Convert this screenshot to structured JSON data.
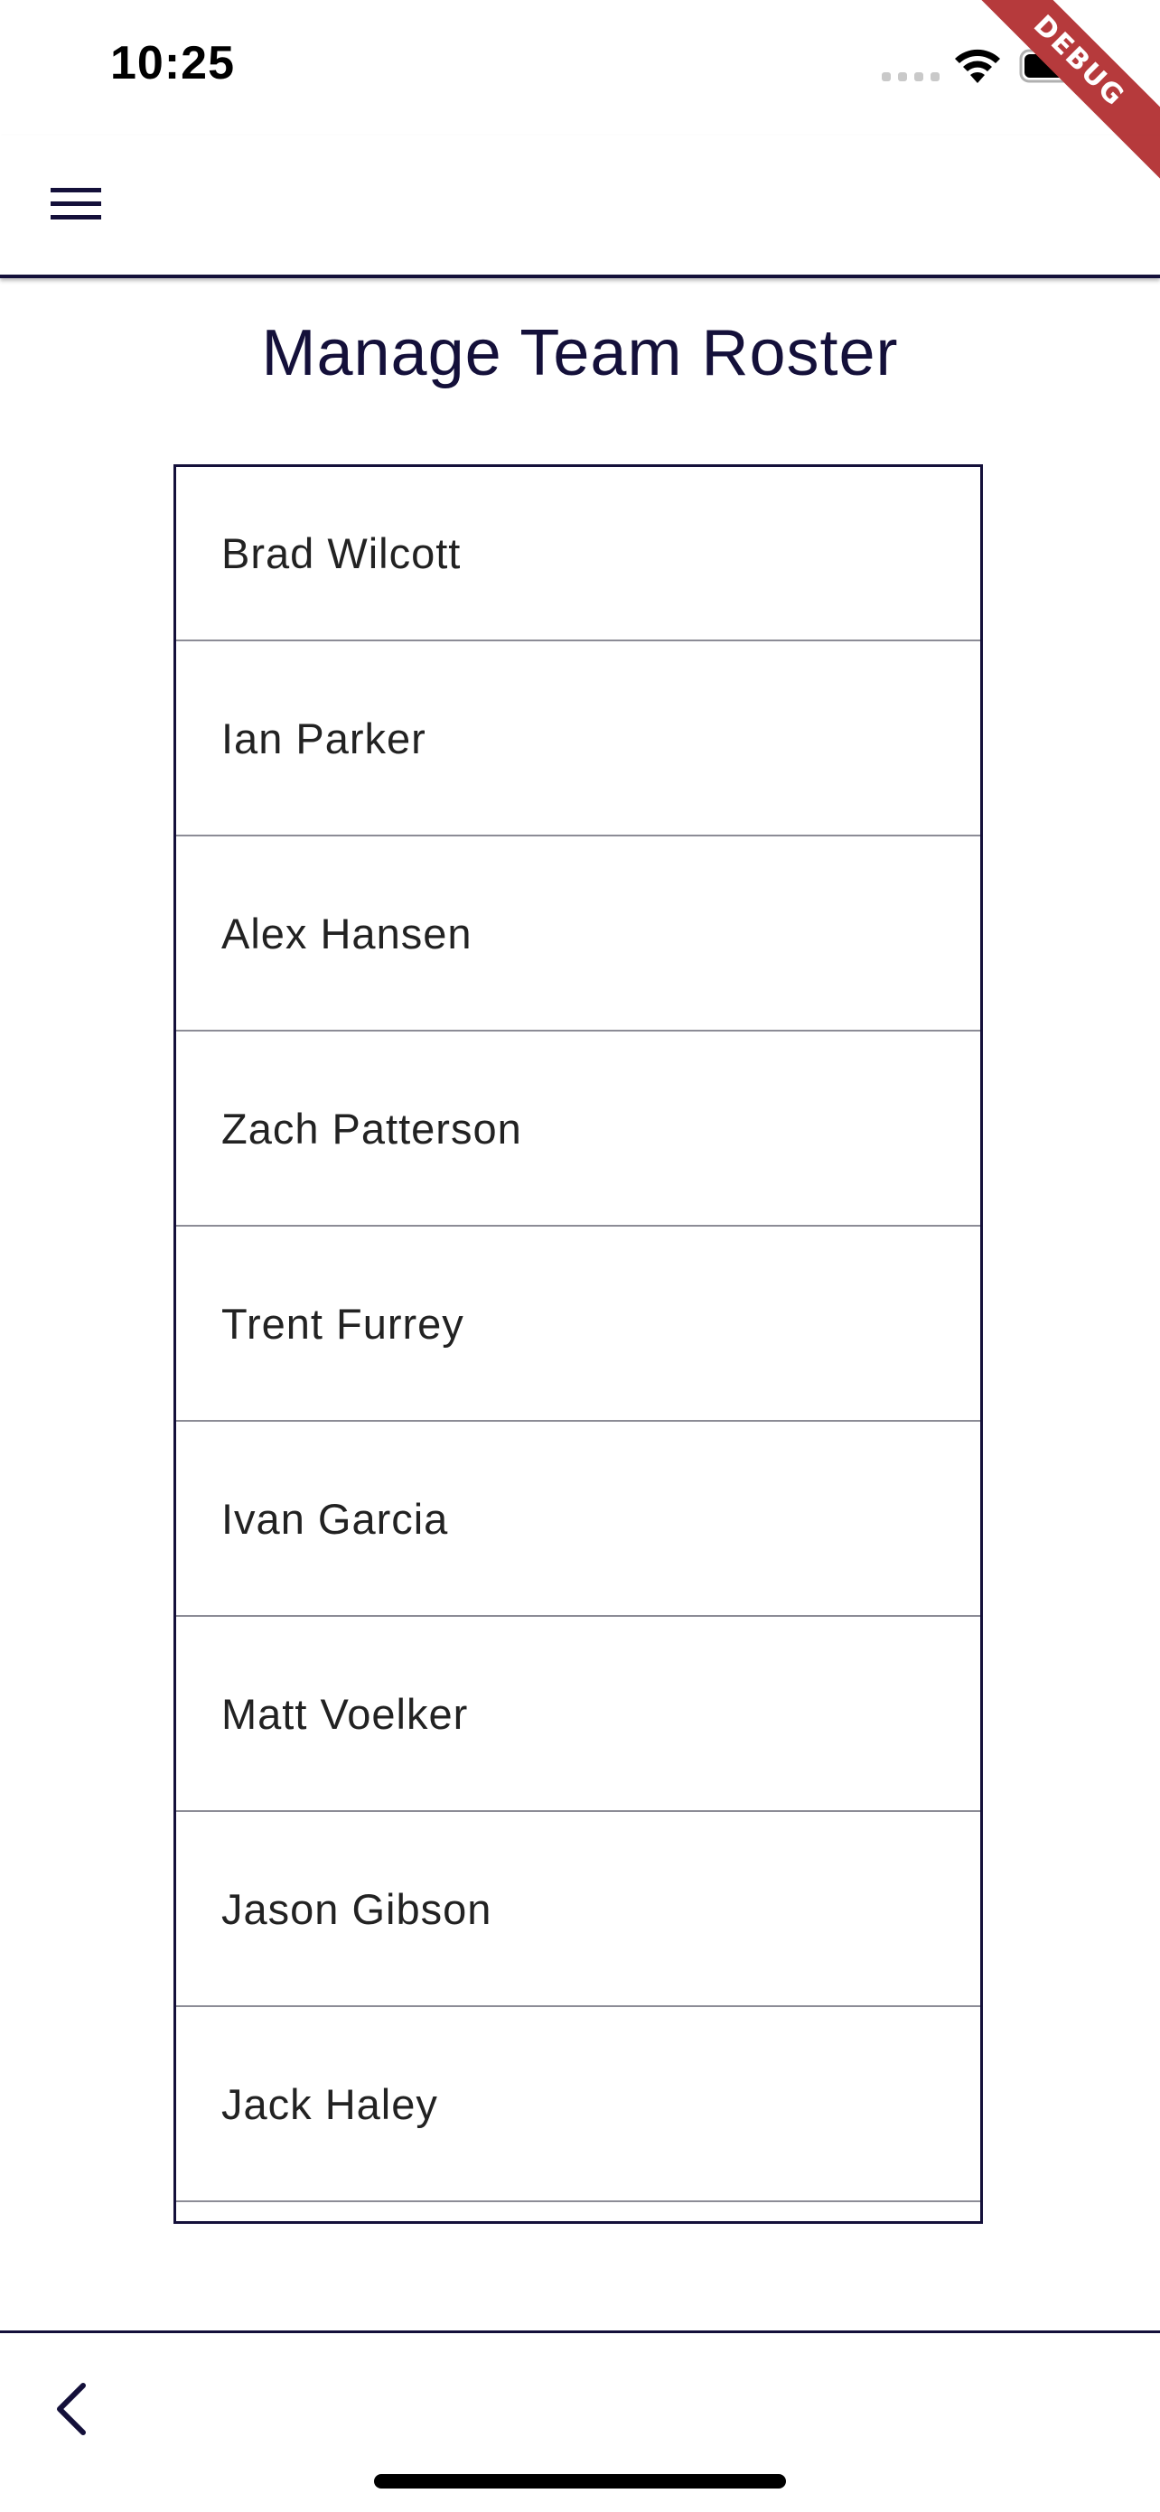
{
  "status_bar": {
    "time": "10:25",
    "debug_label": "DEBUG"
  },
  "app_bar": {
    "menu_icon": "hamburger-menu-icon"
  },
  "page": {
    "title": "Manage Team Roster"
  },
  "roster": {
    "players": [
      {
        "name": "Brad Wilcott"
      },
      {
        "name": "Ian Parker"
      },
      {
        "name": "Alex Hansen"
      },
      {
        "name": "Zach Patterson"
      },
      {
        "name": "Trent Furrey"
      },
      {
        "name": "Ivan Garcia"
      },
      {
        "name": "Matt Voelker"
      },
      {
        "name": "Jason Gibson"
      },
      {
        "name": "Jack Haley"
      },
      {
        "name": ""
      }
    ]
  },
  "bottom_bar": {
    "back_icon": "chevron-left-icon"
  },
  "colors": {
    "primary": "#14103a",
    "divider": "#8c8c96",
    "debug_banner": "#b63a3c"
  }
}
